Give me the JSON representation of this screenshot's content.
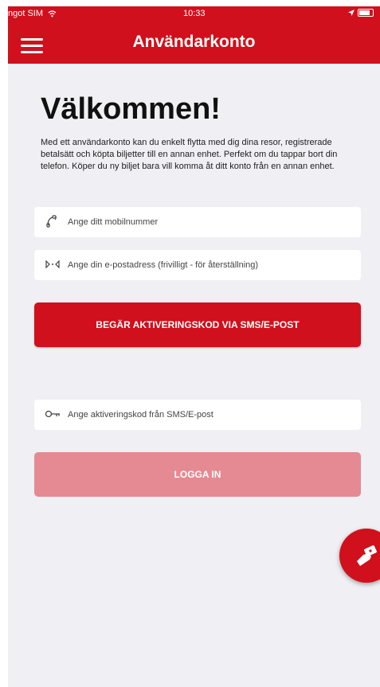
{
  "status_bar": {
    "carrier": "ngot SIM",
    "time": "10:33"
  },
  "header": {
    "title": "Användarkonto",
    "menu_icon": "hamburger-menu-icon"
  },
  "welcome": {
    "heading": "Välkommen!",
    "intro": "Med ett användarkonto kan du enkelt flytta med dig dina resor, registrerade betalsätt och köpta biljetter till en annan enhet. Perfekt om du tappar bort din telefon. Köper du ny biljet bara vill komma åt ditt konto från en annan enhet."
  },
  "form": {
    "phone": {
      "placeholder": "Ange ditt mobilnummer",
      "icon": "phone-icon"
    },
    "email": {
      "placeholder": "Ange din e-postadress (frivilligt - för återställning)",
      "icon": "email-icon"
    },
    "request_button": "BEGÄR AKTIVERINGSKOD VIA SMS/E-POST",
    "code": {
      "placeholder": "Ange aktiveringskod från SMS/E-post",
      "icon": "key-icon"
    },
    "login_button": "LOGGA IN"
  },
  "fab": {
    "icon": "ticket-hand-icon"
  },
  "colors": {
    "brand_red": "#d0101c",
    "disabled_red": "#e58a92",
    "background": "#efeff4"
  }
}
